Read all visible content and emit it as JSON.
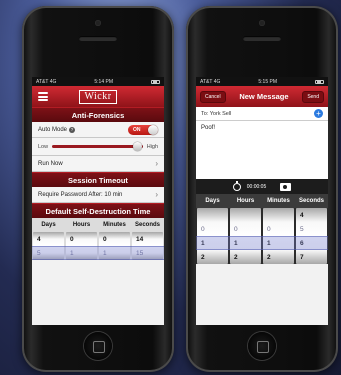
{
  "left_phone": {
    "status": {
      "carrier": "AT&T 4G",
      "time": "5:14 PM"
    },
    "logo": "Wickr",
    "anti_forensics_title": "Anti-Forensics",
    "auto_mode_label": "Auto Mode",
    "auto_mode_toggle": "ON",
    "slider": {
      "low": "Low",
      "high": "High",
      "level": 0.95
    },
    "run_now_label": "Run Now",
    "session_timeout_title": "Session Timeout",
    "require_password_label": "Require Password After: 10 min",
    "destruct_title": "Default Self-Destruction Time",
    "picker": {
      "headers": [
        "Days",
        "Hours",
        "Minutes",
        "Seconds"
      ],
      "columns": [
        [
          "4",
          "5"
        ],
        [
          "0",
          "1"
        ],
        [
          "0",
          "1"
        ],
        [
          "14",
          "15"
        ]
      ]
    }
  },
  "right_phone": {
    "status": {
      "carrier": "AT&T 4G",
      "time": "5:15 PM"
    },
    "cancel_label": "Cancel",
    "title": "New Message",
    "send_label": "Send",
    "to_label": "To: York Sell",
    "message_text": "Poof!",
    "timer_value": "00:00:05",
    "picker": {
      "headers": [
        "Days",
        "Hours",
        "Minutes",
        "Seconds"
      ],
      "columns": [
        [
          "",
          "0",
          "1",
          "2"
        ],
        [
          "",
          "0",
          "1",
          "2"
        ],
        [
          "",
          "0",
          "1",
          "2"
        ],
        [
          "4",
          "5",
          "6",
          "7"
        ]
      ]
    }
  },
  "colors": {
    "accent": "#b81d24",
    "dark": "#5a0a0e"
  }
}
